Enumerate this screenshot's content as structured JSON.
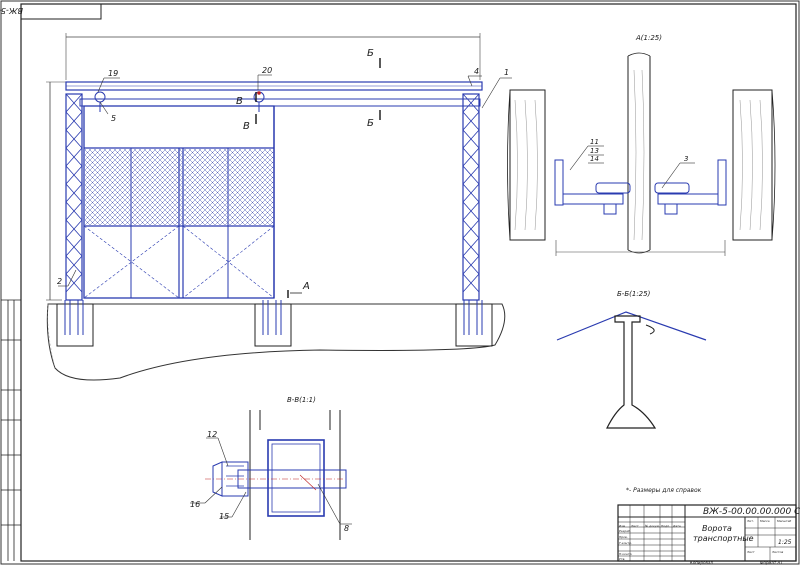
{
  "sheet": {
    "rotated_code": "ВЖ-5-00.00.00.000 СБ",
    "title_code": "ВЖ-5-00.00.00.000 СБ",
    "title_name_line1": "Ворота",
    "title_name_line2": "транспортные",
    "scale": "1:25",
    "footer_left": "Копировал",
    "footer_right": "Формат А1",
    "note": "*- Размеры для справок"
  },
  "views": {
    "view_a": "А(1:25)",
    "view_b": "Б-Б(1:25)",
    "view_v": "В-В(1:1)"
  },
  "section_marks": {
    "A": "А",
    "B": "Б",
    "V": "В"
  },
  "positions": [
    "1",
    "2",
    "3",
    "4",
    "5",
    "8",
    "11",
    "12",
    "13",
    "14",
    "15",
    "16",
    "19",
    "20"
  ],
  "title_block_headers": [
    "Изм",
    "Лист",
    "№ докум.",
    "Подп.",
    "Дата",
    "Разраб.",
    "Пров.",
    "Т.контр.",
    "Н.контр.",
    "Утв.",
    "Лит.",
    "Масса",
    "Масштаб",
    "Лист",
    "Листов"
  ]
}
